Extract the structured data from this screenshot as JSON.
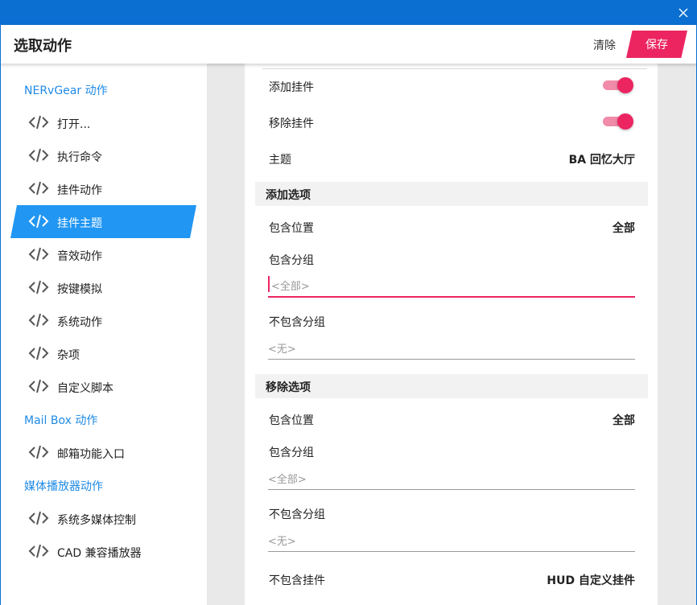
{
  "window": {
    "close_icon": "close-icon"
  },
  "header": {
    "title": "选取动作",
    "clear_label": "清除",
    "save_label": "保存",
    "accent": "#ec2561",
    "titlebar_color": "#0a6fd1"
  },
  "sidebar": {
    "sections": [
      {
        "title": "NERvGear 动作",
        "items": [
          "打开...",
          "执行命令",
          "挂件动作",
          "挂件主题",
          "音效动作",
          "按键模拟",
          "系统动作",
          "杂项",
          "自定义脚本"
        ]
      },
      {
        "title": "Mail Box 动作",
        "items": [
          "邮箱功能入口"
        ]
      },
      {
        "title": "媒体播放器动作",
        "items": [
          "系统多媒体控制",
          "CAD 兼容播放器"
        ]
      }
    ],
    "selected": "挂件主题",
    "item_icon": "code-icon",
    "active_color": "#2196f3"
  },
  "form": {
    "add_widget": {
      "label": "添加挂件",
      "on": true
    },
    "remove_widget": {
      "label": "移除挂件",
      "on": true
    },
    "theme": {
      "label": "主题",
      "value": "BA 回忆大厅"
    },
    "add_options": {
      "title": "添加选项",
      "include_position": {
        "label": "包含位置",
        "value": "全部"
      },
      "include_group": {
        "label": "包含分组",
        "placeholder": "<全部>"
      },
      "exclude_group": {
        "label": "不包含分组",
        "placeholder": "<无>"
      }
    },
    "remove_options": {
      "title": "移除选项",
      "include_position": {
        "label": "包含位置",
        "value": "全部"
      },
      "include_group": {
        "label": "包含分组",
        "placeholder": "<全部>"
      },
      "exclude_group": {
        "label": "不包含分组",
        "placeholder": "<无>"
      },
      "exclude_widget": {
        "label": "不包含挂件",
        "value": "HUD 自定义挂件"
      }
    }
  }
}
